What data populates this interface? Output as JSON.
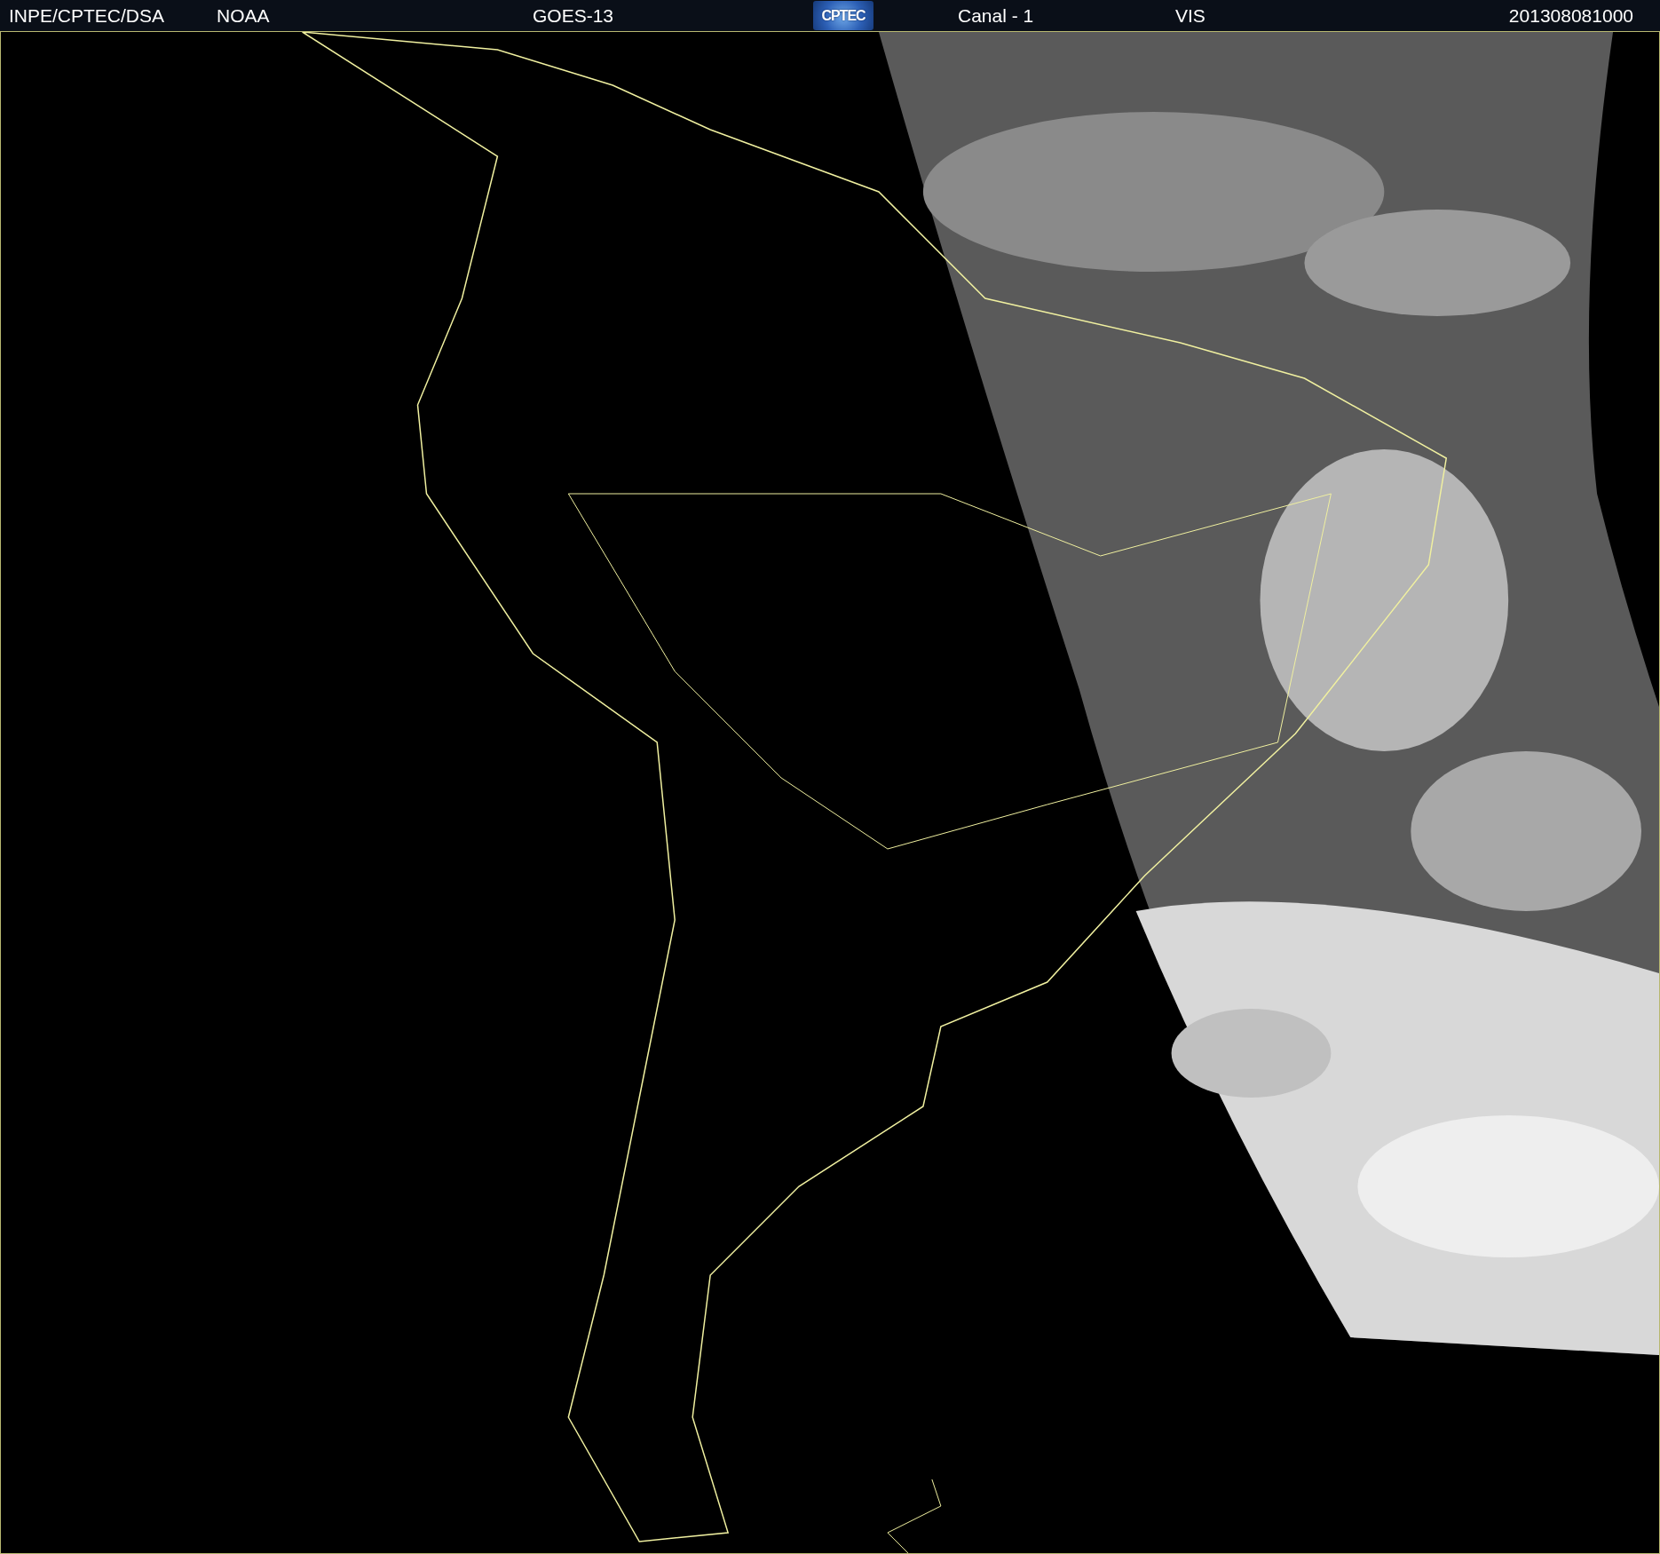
{
  "header": {
    "items": [
      {
        "kind": "text",
        "text": "INPE/CPTEC/DSA"
      },
      {
        "kind": "text",
        "text": "NOAA"
      },
      {
        "kind": "text",
        "text": "GOES-13"
      },
      {
        "kind": "logo",
        "text": "CPTEC"
      },
      {
        "kind": "text",
        "text": "Canal - 1"
      },
      {
        "kind": "text",
        "text": "VIS"
      },
      {
        "kind": "date",
        "text": "201308081000"
      }
    ]
  }
}
